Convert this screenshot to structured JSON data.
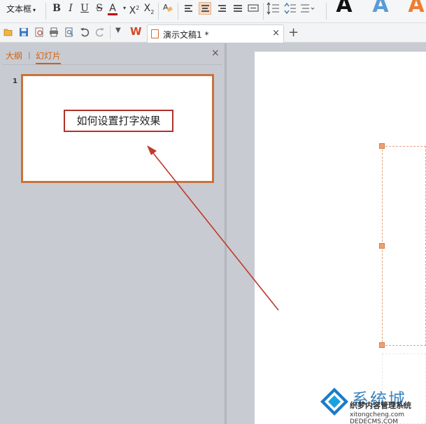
{
  "ribbon": {
    "textbox_dropdown": "文本框",
    "bold": "B",
    "italic": "I",
    "underline": "U",
    "strike": "S",
    "font_color": "A",
    "superscript_base": "X",
    "superscript_mark": "2",
    "subscript_base": "X",
    "subscript_mark": "2",
    "wordart": [
      "A",
      "A",
      "A"
    ],
    "colors": {
      "font_color": "#c00000",
      "accent": "#d0620e",
      "wordart_blue": "#5b9bd5",
      "wordart_orange": "#ed7d31"
    }
  },
  "tabs": {
    "app_logo": "W",
    "document_tab": "演示文稿1 *",
    "close": "×",
    "new_tab": "+"
  },
  "panel": {
    "tab_outline": "大纲",
    "separator": "|",
    "tab_slides": "幻灯片",
    "close": "×",
    "slide_number": "1",
    "thumbnail_text": "如何设置打字效果"
  },
  "watermark": {
    "title": "系统城",
    "line1": "织梦内容管理系统",
    "line2": "DEDECMS.COM",
    "url": "xitongcheng.com"
  }
}
